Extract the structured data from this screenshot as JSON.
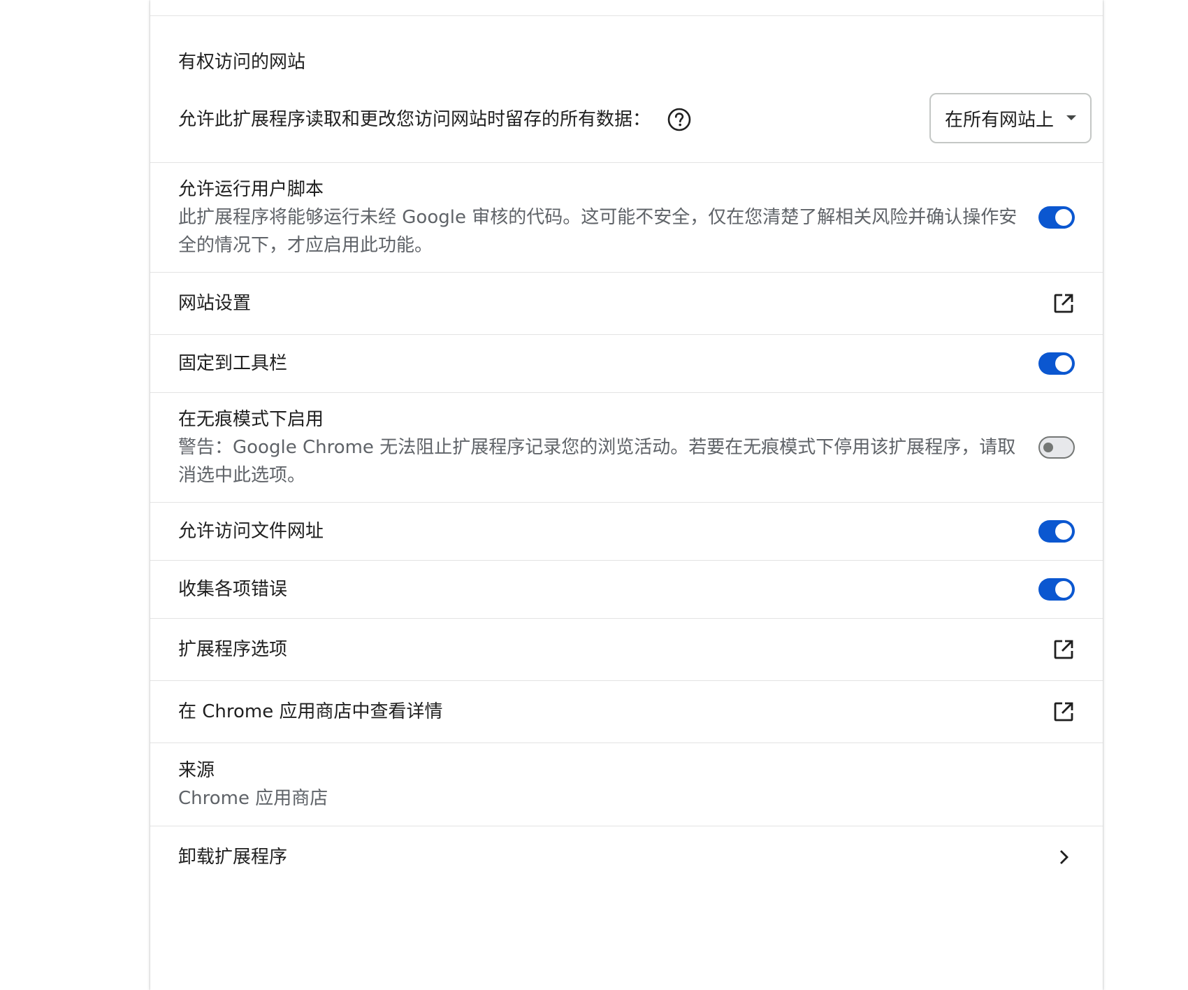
{
  "site_access": {
    "title": "有权访问的网站",
    "label": "允许此扩展程序读取和更改您访问网站时留存的所有数据：",
    "select_value": "在所有网站上"
  },
  "user_scripts": {
    "title": "允许运行用户脚本",
    "description": "此扩展程序将能够运行未经 Google 审核的代码。这可能不安全，仅在您清楚了解相关风险并确认操作安全的情况下，才应启用此功能。",
    "enabled": true
  },
  "site_settings": {
    "title": "网站设置"
  },
  "pin_toolbar": {
    "title": "固定到工具栏",
    "enabled": true
  },
  "incognito": {
    "title": "在无痕模式下启用",
    "description": "警告：Google Chrome 无法阻止扩展程序记录您的浏览活动。若要在无痕模式下停用该扩展程序，请取消选中此选项。",
    "enabled": false
  },
  "file_urls": {
    "title": "允许访问文件网址",
    "enabled": true
  },
  "collect_errors": {
    "title": "收集各项错误",
    "enabled": true
  },
  "extension_options": {
    "title": "扩展程序选项"
  },
  "webstore_details": {
    "title": "在 Chrome 应用商店中查看详情"
  },
  "source": {
    "title": "来源",
    "value": "Chrome 应用商店"
  },
  "uninstall": {
    "title": "卸载扩展程序"
  },
  "colors": {
    "toggle_on": "#0b57d0",
    "toggle_off_border": "#747775",
    "secondary_text": "#5f6368",
    "divider": "#e3e3e3"
  }
}
